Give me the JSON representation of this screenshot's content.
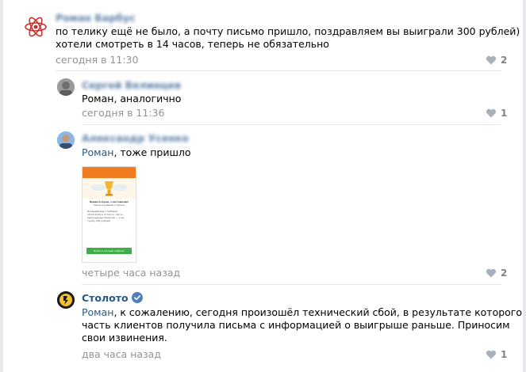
{
  "comments": [
    {
      "author": "Роман Барбус",
      "text_lines": [
        "по телику ещё не было, а почту письмо пришло, поздравляем вы выиграли 300 рублей)",
        "хотели смотреть в 14 часов, теперь не обязательно"
      ],
      "time": "сегодня в 11:30",
      "likes": "2"
    },
    {
      "author": "Сергей Белинцев",
      "text": "Роман, аналогично",
      "time": "сегодня в 11:36",
      "likes": "1"
    },
    {
      "author": "Александр Усенко",
      "mention": "Роман",
      "text_rest": ", тоже пришло",
      "time": "четыре часа назад",
      "likes": "2",
      "attachment": {
        "title": "Приветствуем, счастливчик!",
        "subtitle": "Удача на вашей стороне",
        "body": "Поздравляем с победой 19.03.2016 в Столото. Часть выигрышных билетов — 1 на сумму 300 рублей.",
        "button": "Войти в личный кабинет"
      }
    },
    {
      "author": "Столото",
      "mention": "Роман",
      "text_lines": [
        ", к сожалению, сегодня произошёл технический сбой, в результате которого",
        "часть клиентов получила письма с информацией о выигрыше раньше. Приносим",
        "свои извинения."
      ],
      "time": "два часа назад",
      "likes": "1",
      "colors": {
        "verified": "#5181b8"
      }
    }
  ]
}
